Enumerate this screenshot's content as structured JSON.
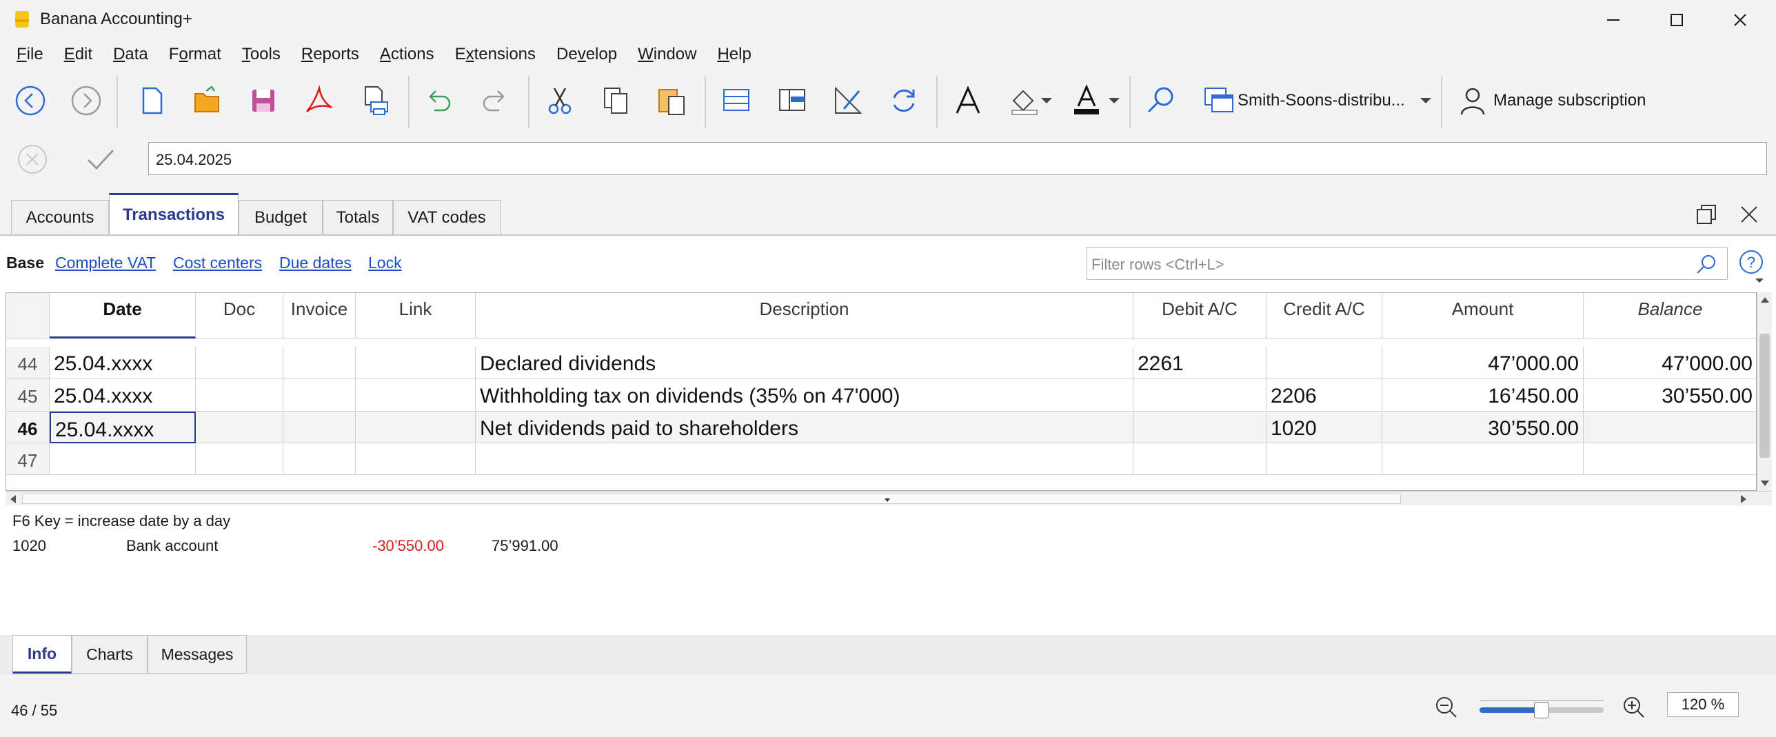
{
  "window": {
    "title": "Banana Accounting+"
  },
  "menu": [
    "File",
    "Edit",
    "Data",
    "Format",
    "Tools",
    "Reports",
    "Actions",
    "Extensions",
    "Develop",
    "Window",
    "Help"
  ],
  "menu_underline": [
    "F",
    "E",
    "D",
    "o",
    "T",
    "R",
    "A",
    "x",
    "v",
    "W",
    "H"
  ],
  "toolbar": {
    "file_name": "Smith-Soons-distribu...",
    "manage_subscription": "Manage subscription"
  },
  "edit_field": {
    "value": "25.04.2025"
  },
  "tabs": [
    "Accounts",
    "Transactions",
    "Budget",
    "Totals",
    "VAT codes"
  ],
  "active_tab": "Transactions",
  "views": {
    "base": "Base",
    "links": [
      "Complete VAT",
      "Cost centers",
      "Due dates",
      "Lock"
    ]
  },
  "filter": {
    "placeholder": "Filter rows <Ctrl+L>"
  },
  "table": {
    "columns": [
      "Date",
      "Doc",
      "Invoice",
      "Link",
      "Description",
      "Debit A/C",
      "Credit A/C",
      "Amount",
      "Balance"
    ],
    "rows": [
      {
        "num": "44",
        "date": "25.04.xxxx",
        "doc": "",
        "invoice": "",
        "link": "",
        "description": "Declared dividends",
        "debit": "2261",
        "credit": "",
        "amount": "47’000.00",
        "balance": "47’000.00"
      },
      {
        "num": "45",
        "date": "25.04.xxxx",
        "doc": "",
        "invoice": "",
        "link": "",
        "description": "Withholding tax on dividends (35% on 47'000)",
        "debit": "",
        "credit": "2206",
        "amount": "16’450.00",
        "balance": "30’550.00"
      },
      {
        "num": "46",
        "date": "25.04.xxxx",
        "doc": "",
        "invoice": "",
        "link": "",
        "description": "Net dividends paid to shareholders",
        "debit": "",
        "credit": "1020",
        "amount": "30’550.00",
        "balance": ""
      },
      {
        "num": "47",
        "date": "",
        "doc": "",
        "invoice": "",
        "link": "",
        "description": "",
        "debit": "",
        "credit": "",
        "amount": "",
        "balance": ""
      }
    ]
  },
  "info": {
    "hint": "F6 Key = increase date by a day",
    "account": "1020",
    "account_name": "Bank account",
    "movement": "-30’550.00",
    "balance": "75’991.00"
  },
  "bottom_tabs": [
    "Info",
    "Charts",
    "Messages"
  ],
  "status": {
    "position": "46 / 55",
    "zoom": "120 %",
    "zoom_level_fraction": 0.5
  },
  "colors": {
    "accent": "#2b3990",
    "link": "#1a4fc9",
    "negative": "#e0191b"
  }
}
